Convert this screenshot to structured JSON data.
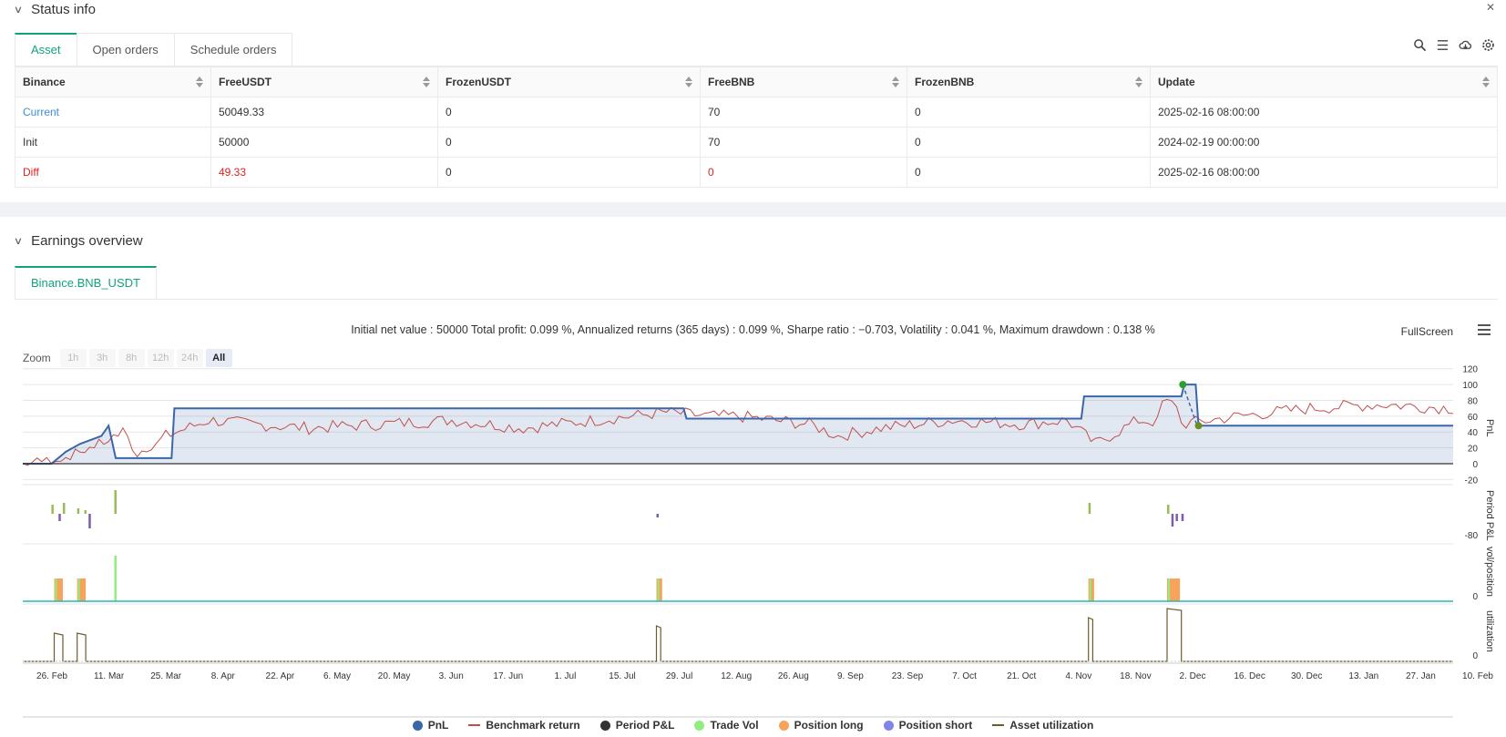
{
  "status_section": {
    "title": "Status info",
    "tabs": [
      "Asset",
      "Open orders",
      "Schedule orders"
    ],
    "table": {
      "headers": [
        "Binance",
        "FreeUSDT",
        "FrozenUSDT",
        "FreeBNB",
        "FrozenBNB",
        "Update"
      ],
      "rows": [
        [
          "Current",
          "50049.33",
          "0",
          "70",
          "0",
          "2025-02-16 08:00:00"
        ],
        [
          "Init",
          "50000",
          "0",
          "70",
          "0",
          "2024-02-19 00:00:00"
        ],
        [
          "Diff",
          "49.33",
          "0",
          "0",
          "0",
          "2025-02-16 08:00:00"
        ]
      ]
    },
    "toolbar_icons": [
      "search-icon",
      "list-icon",
      "cloud-download-icon",
      "gear-icon"
    ]
  },
  "earnings_section": {
    "title": "Earnings overview",
    "tab": "Binance.BNB_USDT",
    "summary": "Initial net value : 50000 Total profit: 0.099 %, Annualized returns (365 days) : 0.099 %, Sharpe ratio : −0.703, Volatility : 0.041 %, Maximum drawdown : 0.138 %",
    "fullscreen_label": "FullScreen",
    "zoom": {
      "label": "Zoom",
      "options": [
        "1h",
        "3h",
        "8h",
        "12h",
        "24h",
        "All"
      ],
      "selected": "All"
    }
  },
  "colors": {
    "accent": "#0fa37f",
    "pnl": "#3a67a8",
    "benchmark": "#c0504d",
    "period_pos": "#9bbb59",
    "period_neg": "#7b5ea7",
    "trade_vol": "#90ee7e",
    "position_long": "#f7a35c",
    "position_short": "#8085e9",
    "utilization": "#6b5b2e"
  },
  "chart_data": {
    "type": "line",
    "x_ticks": [
      "26. Feb",
      "11. Mar",
      "25. Mar",
      "8. Apr",
      "22. Apr",
      "6. May",
      "20. May",
      "3. Jun",
      "17. Jun",
      "1. Jul",
      "15. Jul",
      "29. Jul",
      "12. Aug",
      "26. Aug",
      "9. Sep",
      "23. Sep",
      "7. Oct",
      "21. Oct",
      "4. Nov",
      "18. Nov",
      "2. Dec",
      "16. Dec",
      "30. Dec",
      "13. Jan",
      "27. Jan",
      "10. Feb"
    ],
    "panels": [
      {
        "ylabel": "PnL",
        "y_ticks": [
          "120",
          "100",
          "80",
          "60",
          "40",
          "20",
          "0",
          "-20"
        ],
        "ylim": [
          -20,
          130
        ]
      },
      {
        "ylabel": "Period P&L",
        "y_ticks": [
          "-80"
        ]
      },
      {
        "ylabel": "vol/position",
        "y_ticks": [
          "0"
        ]
      },
      {
        "ylabel": "utilization",
        "y_ticks": [
          "0"
        ]
      }
    ],
    "series": [
      {
        "name": "PnL",
        "x": [
          0,
          0.02,
          0.028,
          0.03,
          0.04,
          0.055,
          0.06,
          0.065,
          0.075,
          0.09,
          0.104,
          0.106,
          0.13,
          0.36,
          0.462,
          0.464,
          0.6,
          0.74,
          0.742,
          0.81,
          0.812,
          0.82,
          0.822,
          1.0
        ],
        "values": [
          0,
          0,
          12,
          15,
          25,
          35,
          48,
          7,
          7,
          7,
          7,
          70,
          70,
          70,
          70,
          57,
          57,
          57,
          85,
          85,
          100,
          100,
          48,
          48
        ]
      },
      {
        "name": "Benchmark return"
      },
      {
        "name": "Period P&L"
      },
      {
        "name": "Trade Vol"
      },
      {
        "name": "Position long"
      },
      {
        "name": "Position short"
      },
      {
        "name": "Asset utilization"
      }
    ],
    "legend": [
      "PnL",
      "Benchmark return",
      "Period P&L",
      "Trade Vol",
      "Position long",
      "Position short",
      "Asset utilization"
    ],
    "legend_position": "bottom"
  }
}
